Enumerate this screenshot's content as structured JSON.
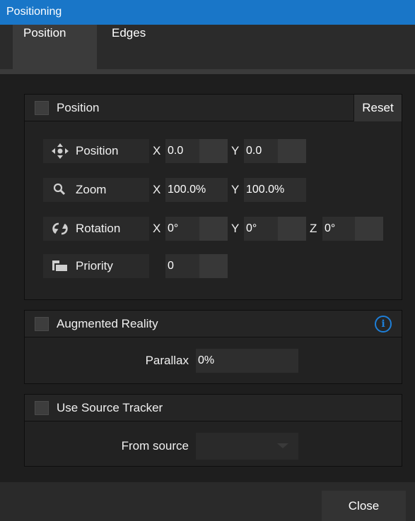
{
  "window": {
    "title": "Positioning"
  },
  "tabs": [
    {
      "label": "Position",
      "active": true
    },
    {
      "label": "Edges",
      "active": false
    }
  ],
  "position_group": {
    "title": "Position",
    "checked": false,
    "reset_label": "Reset",
    "rows": {
      "position": {
        "label": "Position",
        "icon": "move-arrows-icon",
        "x_axis": "X",
        "x_value": "0.0",
        "y_axis": "Y",
        "y_value": "0.0"
      },
      "zoom": {
        "label": "Zoom",
        "icon": "magnifier-icon",
        "x_axis": "X",
        "x_value": "100.0%",
        "y_axis": "Y",
        "y_value": "100.0%"
      },
      "rotation": {
        "label": "Rotation",
        "icon": "rotate-icon",
        "x_axis": "X",
        "x_value": "0°",
        "y_axis": "Y",
        "y_value": "0°",
        "z_axis": "Z",
        "z_value": "0°"
      },
      "priority": {
        "label": "Priority",
        "icon": "layers-icon",
        "value": "0"
      }
    }
  },
  "augmented_reality": {
    "title": "Augmented Reality",
    "checked": false,
    "info_icon": "info-icon",
    "info_glyph": "i",
    "parallax_label": "Parallax",
    "parallax_value": "0%"
  },
  "source_tracker": {
    "title": "Use Source Tracker",
    "checked": false,
    "from_source_label": "From source",
    "from_source_value": ""
  },
  "footer": {
    "close_label": "Close"
  },
  "colors": {
    "titlebar": "#1976c8",
    "accent": "#1e7fd8",
    "background": "#1e1e1e"
  }
}
